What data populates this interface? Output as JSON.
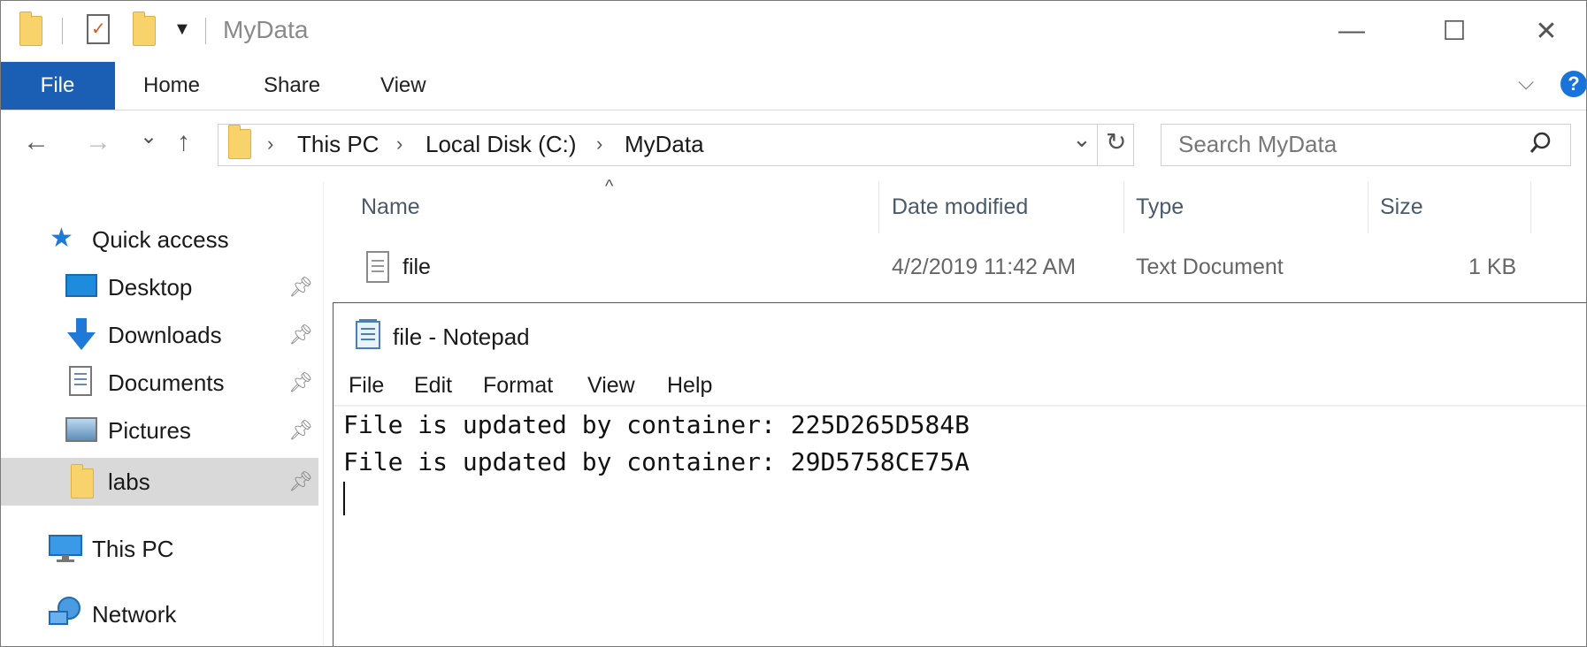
{
  "window": {
    "title": "MyData",
    "minimize_glyph": "—",
    "maximize_glyph": "☐",
    "close_glyph": "✕"
  },
  "ribbon": {
    "tabs": [
      "File",
      "Home",
      "Share",
      "View"
    ],
    "expand_glyph": "⌵",
    "help_glyph": "?"
  },
  "address": {
    "crumbs": [
      "This PC",
      "Local Disk (C:)",
      "MyData"
    ],
    "search_placeholder": "Search MyData"
  },
  "nav": {
    "back": "←",
    "forward": "→",
    "recent": "⌄",
    "up": "↑",
    "dropdown": "⌄",
    "refresh": "↻"
  },
  "sidebar": {
    "quick_access": "Quick access",
    "items": [
      {
        "label": "Desktop",
        "icon": "desktop-icon"
      },
      {
        "label": "Downloads",
        "icon": "download-arrow-icon"
      },
      {
        "label": "Documents",
        "icon": "documents-icon"
      },
      {
        "label": "Pictures",
        "icon": "pictures-icon"
      },
      {
        "label": "labs",
        "icon": "folder-icon"
      }
    ],
    "this_pc": "This PC",
    "network": "Network",
    "selected": "labs"
  },
  "file_list": {
    "columns": [
      "Name",
      "Date modified",
      "Type",
      "Size"
    ],
    "rows": [
      {
        "name": "file",
        "date": "4/2/2019 11:42 AM",
        "type": "Text Document",
        "size": "1 KB"
      }
    ]
  },
  "notepad": {
    "title": "file - Notepad",
    "menu": [
      "File",
      "Edit",
      "Format",
      "View",
      "Help"
    ],
    "lines": [
      "File is updated by container: 225D265D584B",
      "File is updated by container: 29D5758CE75A"
    ]
  },
  "colors": {
    "accent": "#1a5fb4",
    "folder": "#f8d36b",
    "selection": "#d9d9d9"
  }
}
